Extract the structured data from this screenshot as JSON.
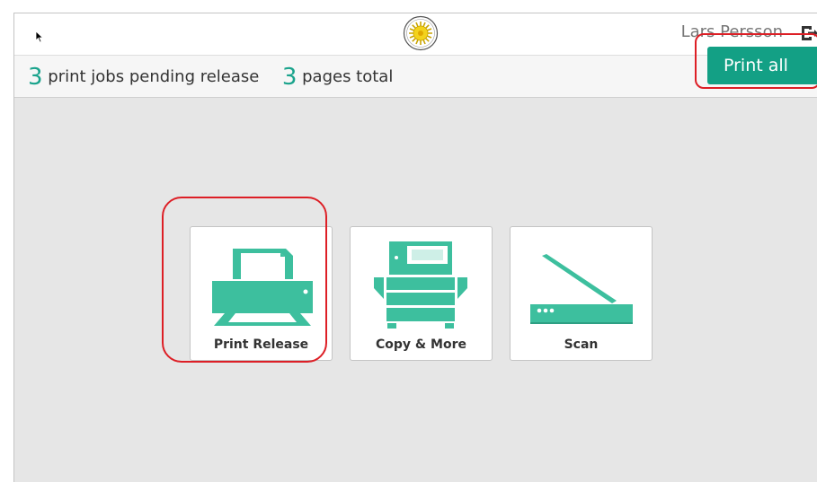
{
  "header": {
    "logo": "university-seal-logo",
    "user_name": "Lars Persson",
    "logout_icon": "logout-icon"
  },
  "summary": {
    "jobs_count": "3",
    "jobs_text": "print jobs pending release",
    "pages_count": "3",
    "pages_text": "pages total",
    "print_all_label": "Print all"
  },
  "tiles": [
    {
      "label": "Print Release",
      "icon": "printer-icon"
    },
    {
      "label": "Copy & More",
      "icon": "copier-icon"
    },
    {
      "label": "Scan",
      "icon": "scanner-icon"
    }
  ],
  "colors": {
    "accent": "#13a085",
    "icon": "#3dbf9e",
    "highlight": "#dd1f26"
  }
}
